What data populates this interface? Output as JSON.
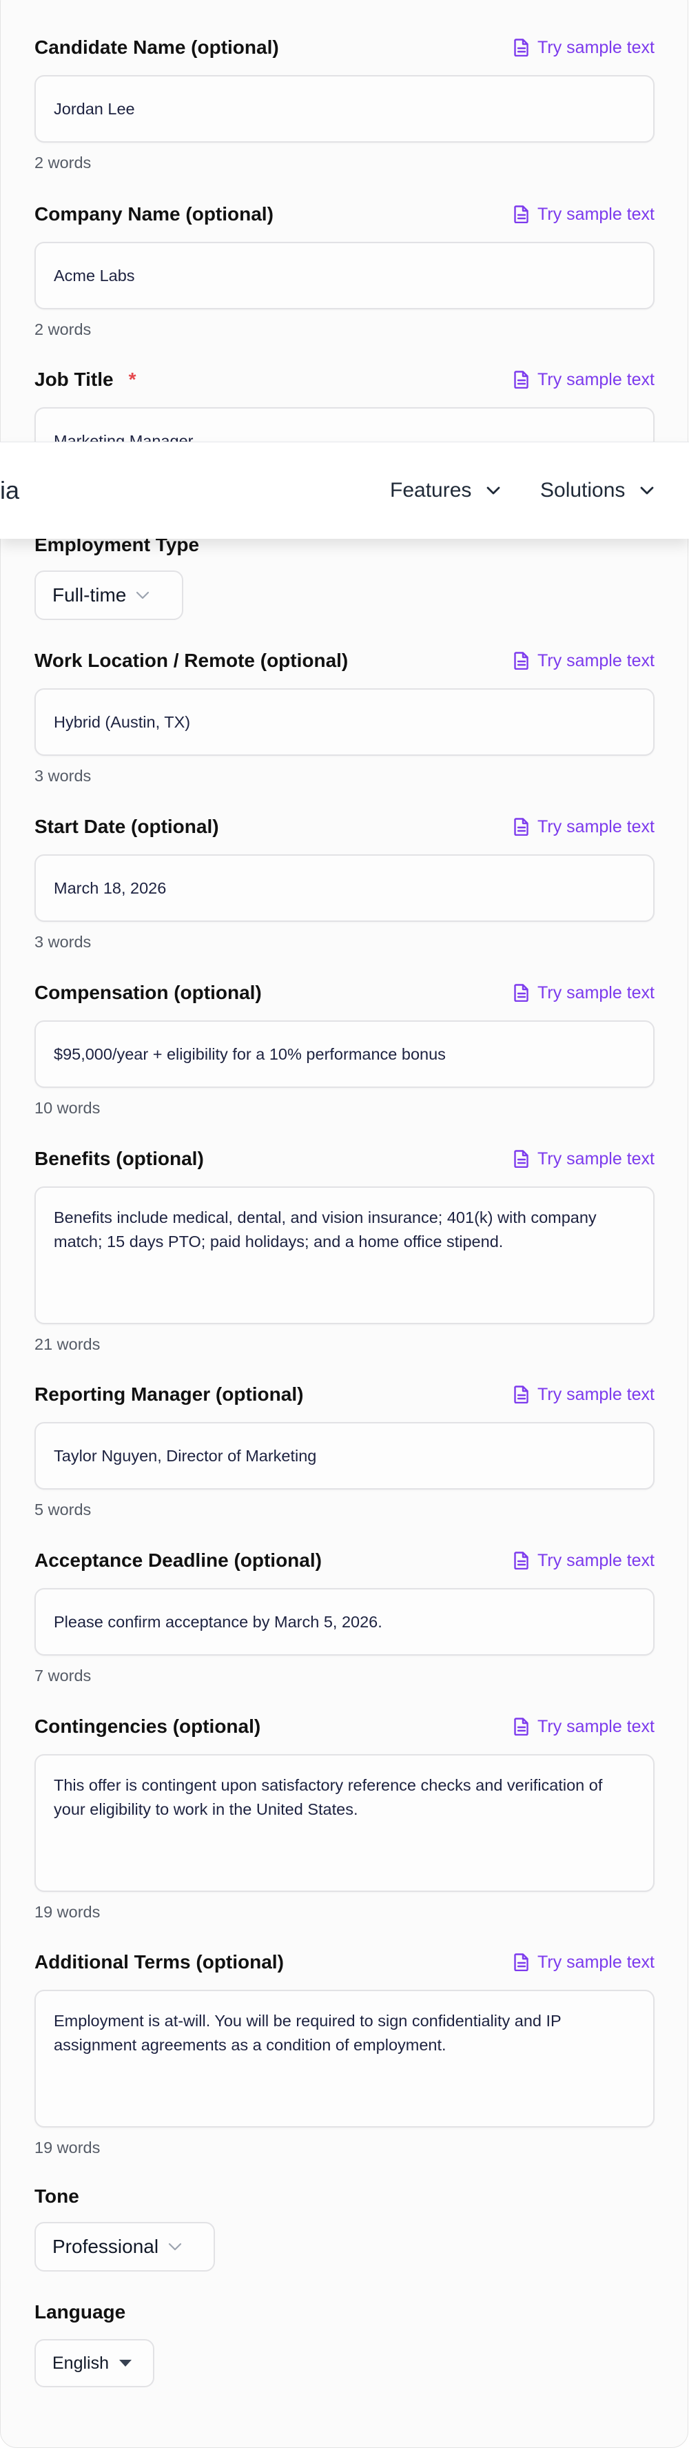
{
  "sample_link_label": "Try sample text",
  "colors": {
    "accent": "#7c3aed",
    "required": "#e5484d"
  },
  "fields_top": [
    {
      "label": "Candidate Name (optional)",
      "value": "Jordan Lee",
      "count": "2 words"
    },
    {
      "label": "Company Name (optional)",
      "value": "Acme Labs",
      "count": "2 words"
    },
    {
      "label": "Job Title",
      "required_mark": "*",
      "value": "Marketing Manager"
    }
  ],
  "nav": {
    "logo_fragment": "ia",
    "items": [
      {
        "label": "Features"
      },
      {
        "label": "Solutions"
      }
    ]
  },
  "employment_type": {
    "label": "Employment Type",
    "selected": "Full-time"
  },
  "fields_bottom": [
    {
      "label": "Work Location / Remote (optional)",
      "value": "Hybrid (Austin, TX)",
      "count": "3 words"
    },
    {
      "label": "Start Date (optional)",
      "value": "March 18, 2026",
      "count": "3 words"
    },
    {
      "label": "Compensation (optional)",
      "value": "$95,000/year + eligibility for a 10% performance bonus",
      "count": "10 words"
    },
    {
      "label": "Benefits (optional)",
      "value": "Benefits include medical, dental, and vision insurance; 401(k) with company match; 15 days PTO; paid holidays; and a home office stipend.",
      "count": "21 words"
    },
    {
      "label": "Reporting Manager (optional)",
      "value": "Taylor Nguyen, Director of Marketing",
      "count": "5 words"
    },
    {
      "label": "Acceptance Deadline (optional)",
      "value": "Please confirm acceptance by March 5, 2026.",
      "count": "7 words"
    },
    {
      "label": "Contingencies (optional)",
      "value": "This offer is contingent upon satisfactory reference checks and verification of your eligibility to work in the United States.",
      "count": "19 words"
    },
    {
      "label": "Additional Terms (optional)",
      "value": "Employment is at-will. You will be required to sign confidentiality and IP assignment agreements as a condition of employment.",
      "count": "19 words"
    }
  ],
  "tone": {
    "label": "Tone",
    "selected": "Professional"
  },
  "language": {
    "label": "Language",
    "selected": "English"
  }
}
